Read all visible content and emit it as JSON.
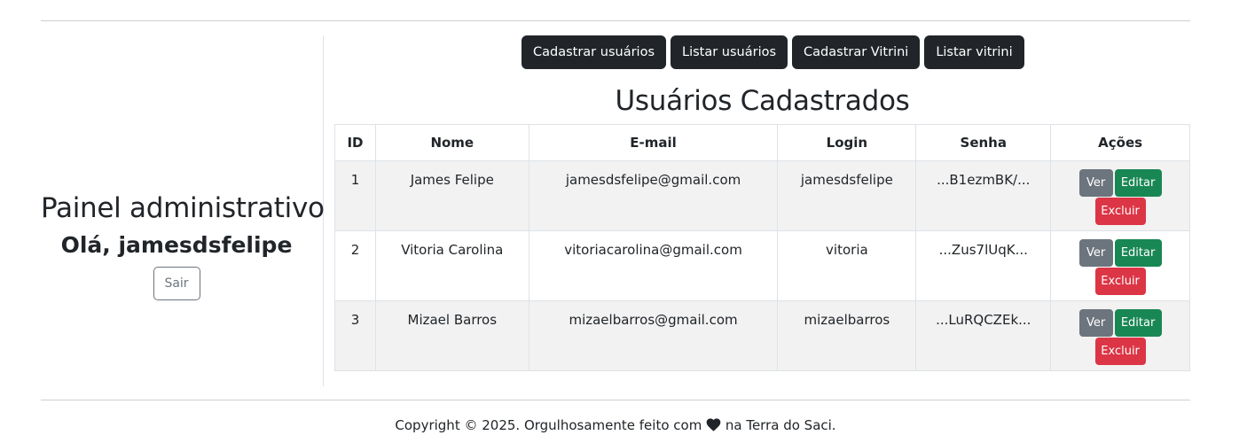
{
  "sidebar": {
    "title": "Painel administrativo",
    "greeting": "Olá, jamesdsfelipe",
    "logout_label": "Sair"
  },
  "nav": {
    "items": [
      {
        "label": "Cadastrar usuários"
      },
      {
        "label": "Listar usuários"
      },
      {
        "label": "Cadastrar Vitrini"
      },
      {
        "label": "Listar vitrini"
      }
    ]
  },
  "main": {
    "heading": "Usuários Cadastrados",
    "table": {
      "headers": [
        "ID",
        "Nome",
        "E-mail",
        "Login",
        "Senha",
        "Ações"
      ],
      "rows": [
        {
          "id": "1",
          "name": "James Felipe",
          "email": "jamesdsfelipe@gmail.com",
          "login": "jamesdsfelipe",
          "password": "...B1ezmBK/..."
        },
        {
          "id": "2",
          "name": "Vitoria Carolina",
          "email": "vitoriacarolina@gmail.com",
          "login": "vitoria",
          "password": "...Zus7lUqK..."
        },
        {
          "id": "3",
          "name": "Mizael Barros",
          "email": "mizaelbarros@gmail.com",
          "login": "mizaelbarros",
          "password": "...LuRQCZEk..."
        }
      ],
      "actions": {
        "view_label": "Ver",
        "edit_label": "Editar",
        "delete_label": "Excluir"
      }
    }
  },
  "footer": {
    "text_before": "Copyright © 2025. Orgulhosamente feito com",
    "heart_icon": "heart-icon",
    "text_after": "na Terra do Saci."
  },
  "colors": {
    "dark": "#212529",
    "secondary": "#6c757d",
    "success": "#198754",
    "danger": "#dc3545",
    "stripe": "#f2f2f2"
  }
}
